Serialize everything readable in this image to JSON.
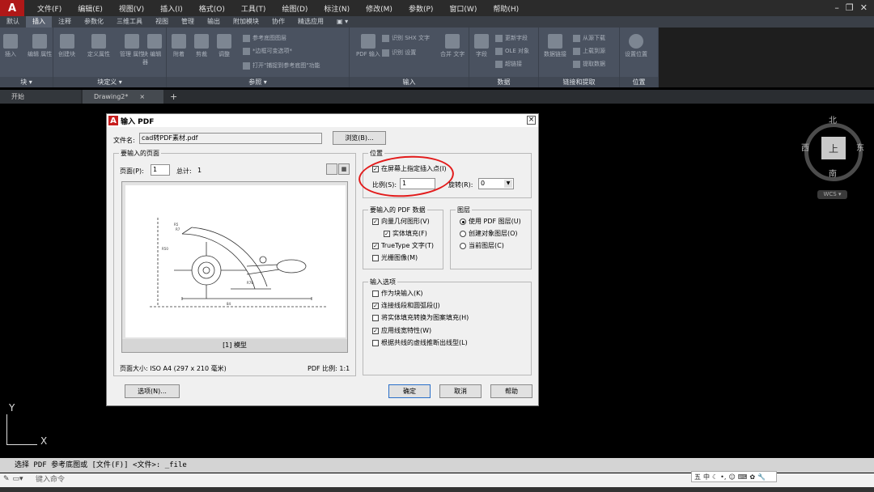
{
  "menu": {
    "items": [
      "文件(F)",
      "编辑(E)",
      "视图(V)",
      "插入(I)",
      "格式(O)",
      "工具(T)",
      "绘图(D)",
      "标注(N)",
      "修改(M)",
      "参数(P)",
      "窗口(W)",
      "帮助(H)"
    ]
  },
  "ribbon": {
    "tabs": [
      "默认",
      "插入",
      "注释",
      "参数化",
      "三维工具",
      "视图",
      "管理",
      "输出",
      "附加模块",
      "协作",
      "精选应用"
    ],
    "active_tab": "插入",
    "panels": {
      "block": {
        "title": "块 ▾",
        "tools": [
          "插入",
          "编辑\n属性"
        ]
      },
      "block_def": {
        "title": "块定义 ▾",
        "tools": [
          "创建块",
          "定义属性",
          "管理\n属性",
          "块\n编辑器"
        ]
      },
      "reference": {
        "title": "参照 ▾",
        "tools": [
          "附着",
          "剪裁",
          "调整"
        ],
        "small": [
          "参考底图图层",
          "*边框可变选项*",
          "打开\"捕捉到参考底图\"功能"
        ]
      },
      "import": {
        "title": "输入",
        "tools": [
          "PDF\n输入"
        ],
        "small": [
          "识别 SHX 文字",
          "识别 设置"
        ],
        "tool2": "合并\n文字"
      },
      "data": {
        "title": "数据",
        "tools": [
          "字段"
        ],
        "small": [
          "更新字段",
          "OLE 对象",
          "超链接"
        ]
      },
      "link": {
        "title": "链接和提取",
        "tools": [
          "数据链接"
        ],
        "small": [
          "从源下载",
          "上载到源",
          "提取数据"
        ]
      },
      "location": {
        "title": "位置",
        "tools": [
          "设置位置"
        ]
      }
    }
  },
  "doc_tabs": {
    "start": "开始",
    "drawing": "Drawing2*",
    "close": "×",
    "add": "+"
  },
  "viewcube": {
    "north": "北",
    "south": "南",
    "west": "西",
    "east": "东",
    "face": "上",
    "wcs": "WCS ▾"
  },
  "ucs": {
    "x": "X",
    "y": "Y"
  },
  "dialog": {
    "title": "输入 PDF",
    "close": "×",
    "file_label": "文件名:",
    "file_value": "cad转PDF素材.pdf",
    "browse": "浏览(B)...",
    "pages_group": "要输入的页面",
    "page_label": "页面(P):",
    "page_value": "1",
    "total_label": "总计:",
    "total_value": "1",
    "preview_caption": "[1] 模型",
    "page_size": "页面大小: ISO A4 (297 x 210 毫米)",
    "pdf_scale": "PDF 比例: 1:1",
    "position_group": "位置",
    "specify_on_screen": "在屏幕上指定插入点(I)",
    "scale_label": "比例(S):",
    "scale_value": "1",
    "rotation_label": "旋转(R):",
    "rotation_value": "0",
    "pdf_data_group": "要输入的 PDF 数据",
    "vector": "向量几何图形(V)",
    "solid_fill": "实体填充(F)",
    "truetype": "TrueType 文字(T)",
    "raster": "光栅图像(M)",
    "layers_group": "图层",
    "use_pdf_layers": "使用 PDF 图层(U)",
    "create_object_layers": "创建对象图层(O)",
    "current_layer": "当前图层(C)",
    "import_options_group": "输入选项",
    "as_block": "作为块输入(K)",
    "join_segments": "连接线段和圆弧段(J)",
    "convert_fills": "将实体填充转换为图案填充(H)",
    "apply_lineweight": "应用线宽特性(W)",
    "infer_linetypes": "根据共线的虚线推断出线型(L)",
    "options_btn": "选项(N)...",
    "ok_btn": "确定",
    "cancel_btn": "取消",
    "help_btn": "帮助",
    "checks": {
      "specify_on_screen": true,
      "vector": true,
      "solid_fill": true,
      "truetype": true,
      "raster": false,
      "as_block": false,
      "join_segments": true,
      "convert_fills": false,
      "apply_lineweight": true,
      "infer_linetypes": false
    },
    "layer_selected": "use_pdf_layers"
  },
  "command": {
    "history": "选择 PDF 参考底图或 [文件(F)] <文件>: _file",
    "placeholder": "键入命令"
  },
  "ime": {
    "label": "五",
    "mode": "中"
  },
  "colors": {
    "annotation_circle": "#e21b1b",
    "ribbon": "#4a5260",
    "dialog_bg": "#f0f0f0"
  }
}
